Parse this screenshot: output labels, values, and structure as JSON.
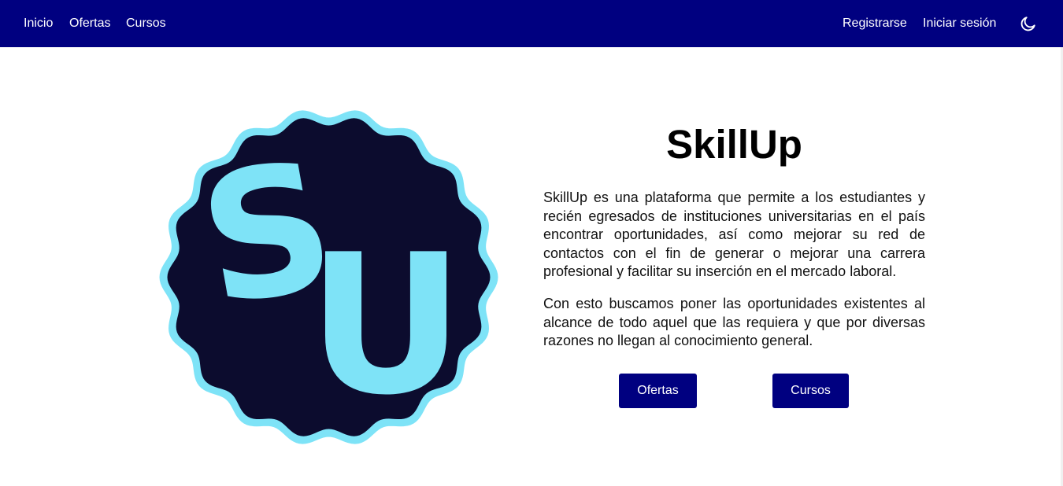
{
  "nav": {
    "left_links": [
      "Inicio",
      "Ofertas",
      "Cursos"
    ],
    "right_links": [
      "Registrarse",
      "Iniciar sesión"
    ],
    "theme_toggle_icon": "moon-icon"
  },
  "hero": {
    "logo_text": "SU",
    "title": "SkillUp",
    "paragraphs": [
      "SkillUp es una plataforma que permite a los estudiantes y recién egresados de instituciones universitarias en el país encontrar oportunidades, así como mejorar su red de contactos con el fin de generar o mejorar una carrera profesional y facilitar su inserción en el mercado laboral.",
      "Con esto buscamos poner las oportunidades existentes al alcance de todo aquel que las requiera y que por diversas razones no llegan al conocimiento general."
    ],
    "buttons": [
      "Ofertas",
      "Cursos"
    ]
  },
  "colors": {
    "navbar": "#000080",
    "button": "#000080",
    "logo_dark": "#0c0c2e",
    "logo_accent": "#7ee3f7"
  }
}
